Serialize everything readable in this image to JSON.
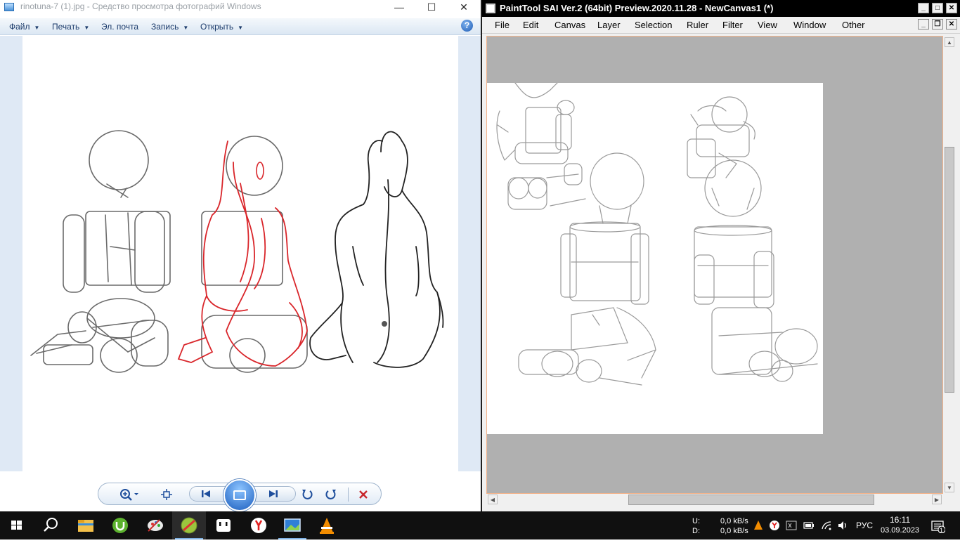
{
  "viewer": {
    "title": "rinotuna-7 (1).jpg - Средство просмотра фотографий Windows",
    "window_controls": {
      "minimize": "—",
      "maximize": "☐",
      "close": "✕"
    },
    "menu": [
      {
        "label": "Файл"
      },
      {
        "label": "Печать"
      },
      {
        "label": "Эл. почта"
      },
      {
        "label": "Запись"
      },
      {
        "label": "Открыть"
      }
    ],
    "help_label": "?",
    "icons": [
      "zoom-icon",
      "fit-window-icon",
      "previous-icon",
      "slideshow-icon",
      "next-icon",
      "rotate-left-icon",
      "rotate-right-icon",
      "delete-icon"
    ]
  },
  "sai": {
    "title": "PaintTool SAI Ver.2 (64bit) Preview.2020.11.28 - NewCanvas1 (*)",
    "menu": [
      {
        "label": "File"
      },
      {
        "label": "Edit"
      },
      {
        "label": "Canvas"
      },
      {
        "label": "Layer"
      },
      {
        "label": "Selection"
      },
      {
        "label": "Ruler"
      },
      {
        "label": "Filter"
      },
      {
        "label": "View"
      },
      {
        "label": "Window"
      },
      {
        "label": "Other"
      }
    ]
  },
  "taskbar": {
    "apps": [
      "windows-start-icon",
      "search-icon",
      "file-explorer-icon",
      "utorrent-icon",
      "paint-icon",
      "paint-tool-icon",
      "notepad-icon",
      "yandex-browser-icon",
      "photo-viewer-icon",
      "vlc-icon"
    ],
    "network": {
      "upload_label": "U:",
      "download_label": "D:",
      "upload_speed": "0,0 kB/s",
      "download_speed": "0,0 kB/s"
    },
    "language": "РУС",
    "time": "16:11",
    "date": "03.09.2023",
    "notifications": "1"
  }
}
